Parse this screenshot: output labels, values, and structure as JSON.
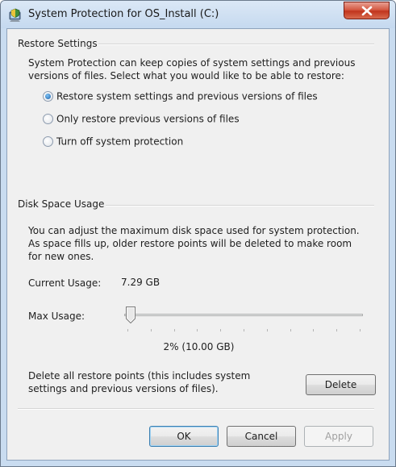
{
  "window": {
    "title": "System Protection for OS_Install (C:)",
    "icon": "shield-computer-icon",
    "close_icon": "close-icon",
    "close_color": "#c1351d"
  },
  "restore_settings": {
    "heading": "Restore Settings",
    "description": "System Protection can keep copies of system settings and previous versions of files. Select what you would like to be able to restore:",
    "options": [
      {
        "label": "Restore system settings and previous versions of files",
        "checked": true
      },
      {
        "label": "Only restore previous versions of files",
        "checked": false
      },
      {
        "label": "Turn off system protection",
        "checked": false
      }
    ]
  },
  "disk_space": {
    "heading": "Disk Space Usage",
    "description": "You can adjust the maximum disk space used for system protection. As space fills up, older restore points will be deleted to make room for new ones.",
    "current_usage_label": "Current Usage:",
    "current_usage_value": "7.29 GB",
    "max_usage_label": "Max Usage:",
    "max_usage_percent": 2,
    "max_usage_text": "2% (10.00 GB)",
    "delete_text": "Delete all restore points (this includes system settings and previous versions of files).",
    "delete_button": "Delete"
  },
  "buttons": {
    "ok": "OK",
    "cancel": "Cancel",
    "apply": "Apply"
  }
}
